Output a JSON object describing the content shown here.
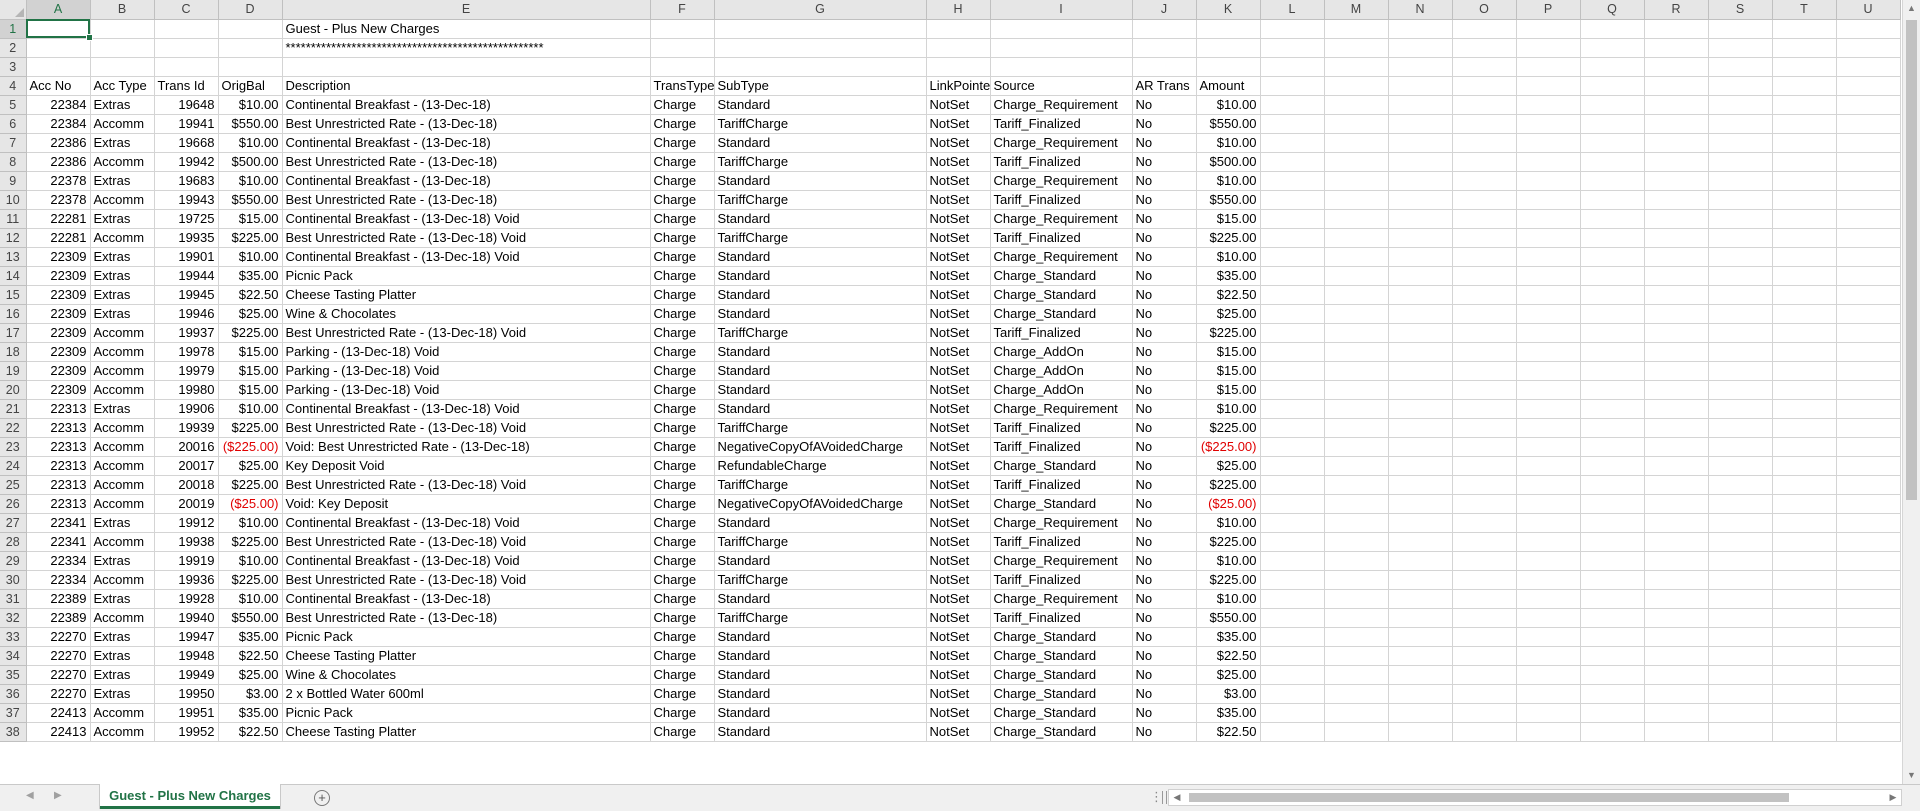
{
  "columns": [
    "A",
    "B",
    "C",
    "D",
    "E",
    "F",
    "G",
    "H",
    "I",
    "J",
    "K",
    "L",
    "M",
    "N",
    "O",
    "P",
    "Q",
    "R",
    "S",
    "T",
    "U"
  ],
  "selected_cell": "A1",
  "title_row": {
    "report_title": "Guest - Plus New Charges",
    "underline": "***************************************************"
  },
  "headers": [
    "Acc No",
    "Acc Type",
    "Trans Id",
    "OrigBal",
    "Description",
    "TransType",
    "SubType",
    "LinkPointe",
    "Source",
    "AR Trans",
    "Amount"
  ],
  "rows": [
    [
      "22384",
      "Extras",
      "19648",
      "$10.00",
      "Continental Breakfast - (13-Dec-18)",
      "Charge",
      "Standard",
      "NotSet",
      "Charge_Requirement",
      "No",
      "$10.00"
    ],
    [
      "22384",
      "Accomm",
      "19941",
      "$550.00",
      "Best Unrestricted Rate - (13-Dec-18)",
      "Charge",
      "TariffCharge",
      "NotSet",
      "Tariff_Finalized",
      "No",
      "$550.00"
    ],
    [
      "22386",
      "Extras",
      "19668",
      "$10.00",
      "Continental Breakfast - (13-Dec-18)",
      "Charge",
      "Standard",
      "NotSet",
      "Charge_Requirement",
      "No",
      "$10.00"
    ],
    [
      "22386",
      "Accomm",
      "19942",
      "$500.00",
      "Best Unrestricted Rate - (13-Dec-18)",
      "Charge",
      "TariffCharge",
      "NotSet",
      "Tariff_Finalized",
      "No",
      "$500.00"
    ],
    [
      "22378",
      "Extras",
      "19683",
      "$10.00",
      "Continental Breakfast - (13-Dec-18)",
      "Charge",
      "Standard",
      "NotSet",
      "Charge_Requirement",
      "No",
      "$10.00"
    ],
    [
      "22378",
      "Accomm",
      "19943",
      "$550.00",
      "Best Unrestricted Rate - (13-Dec-18)",
      "Charge",
      "TariffCharge",
      "NotSet",
      "Tariff_Finalized",
      "No",
      "$550.00"
    ],
    [
      "22281",
      "Extras",
      "19725",
      "$15.00",
      "Continental Breakfast - (13-Dec-18) Void",
      "Charge",
      "Standard",
      "NotSet",
      "Charge_Requirement",
      "No",
      "$15.00"
    ],
    [
      "22281",
      "Accomm",
      "19935",
      "$225.00",
      "Best Unrestricted Rate - (13-Dec-18) Void",
      "Charge",
      "TariffCharge",
      "NotSet",
      "Tariff_Finalized",
      "No",
      "$225.00"
    ],
    [
      "22309",
      "Extras",
      "19901",
      "$10.00",
      "Continental Breakfast - (13-Dec-18) Void",
      "Charge",
      "Standard",
      "NotSet",
      "Charge_Requirement",
      "No",
      "$10.00"
    ],
    [
      "22309",
      "Extras",
      "19944",
      "$35.00",
      "Picnic Pack",
      "Charge",
      "Standard",
      "NotSet",
      "Charge_Standard",
      "No",
      "$35.00"
    ],
    [
      "22309",
      "Extras",
      "19945",
      "$22.50",
      "Cheese Tasting Platter",
      "Charge",
      "Standard",
      "NotSet",
      "Charge_Standard",
      "No",
      "$22.50"
    ],
    [
      "22309",
      "Extras",
      "19946",
      "$25.00",
      "Wine & Chocolates",
      "Charge",
      "Standard",
      "NotSet",
      "Charge_Standard",
      "No",
      "$25.00"
    ],
    [
      "22309",
      "Accomm",
      "19937",
      "$225.00",
      "Best Unrestricted Rate - (13-Dec-18) Void",
      "Charge",
      "TariffCharge",
      "NotSet",
      "Tariff_Finalized",
      "No",
      "$225.00"
    ],
    [
      "22309",
      "Accomm",
      "19978",
      "$15.00",
      "Parking - (13-Dec-18) Void",
      "Charge",
      "Standard",
      "NotSet",
      "Charge_AddOn",
      "No",
      "$15.00"
    ],
    [
      "22309",
      "Accomm",
      "19979",
      "$15.00",
      "Parking - (13-Dec-18) Void",
      "Charge",
      "Standard",
      "NotSet",
      "Charge_AddOn",
      "No",
      "$15.00"
    ],
    [
      "22309",
      "Accomm",
      "19980",
      "$15.00",
      "Parking - (13-Dec-18) Void",
      "Charge",
      "Standard",
      "NotSet",
      "Charge_AddOn",
      "No",
      "$15.00"
    ],
    [
      "22313",
      "Extras",
      "19906",
      "$10.00",
      "Continental Breakfast - (13-Dec-18) Void",
      "Charge",
      "Standard",
      "NotSet",
      "Charge_Requirement",
      "No",
      "$10.00"
    ],
    [
      "22313",
      "Accomm",
      "19939",
      "$225.00",
      "Best Unrestricted Rate - (13-Dec-18) Void",
      "Charge",
      "TariffCharge",
      "NotSet",
      "Tariff_Finalized",
      "No",
      "$225.00"
    ],
    [
      "22313",
      "Accomm",
      "20016",
      "($225.00)",
      "Void: Best Unrestricted Rate - (13-Dec-18)",
      "Charge",
      "NegativeCopyOfAVoidedCharge",
      "NotSet",
      "Tariff_Finalized",
      "No",
      "($225.00)"
    ],
    [
      "22313",
      "Accomm",
      "20017",
      "$25.00",
      "Key Deposit Void",
      "Charge",
      "RefundableCharge",
      "NotSet",
      "Charge_Standard",
      "No",
      "$25.00"
    ],
    [
      "22313",
      "Accomm",
      "20018",
      "$225.00",
      "Best Unrestricted Rate - (13-Dec-18) Void",
      "Charge",
      "TariffCharge",
      "NotSet",
      "Tariff_Finalized",
      "No",
      "$225.00"
    ],
    [
      "22313",
      "Accomm",
      "20019",
      "($25.00)",
      "Void: Key Deposit",
      "Charge",
      "NegativeCopyOfAVoidedCharge",
      "NotSet",
      "Charge_Standard",
      "No",
      "($25.00)"
    ],
    [
      "22341",
      "Extras",
      "19912",
      "$10.00",
      "Continental Breakfast - (13-Dec-18) Void",
      "Charge",
      "Standard",
      "NotSet",
      "Charge_Requirement",
      "No",
      "$10.00"
    ],
    [
      "22341",
      "Accomm",
      "19938",
      "$225.00",
      "Best Unrestricted Rate - (13-Dec-18) Void",
      "Charge",
      "TariffCharge",
      "NotSet",
      "Tariff_Finalized",
      "No",
      "$225.00"
    ],
    [
      "22334",
      "Extras",
      "19919",
      "$10.00",
      "Continental Breakfast - (13-Dec-18) Void",
      "Charge",
      "Standard",
      "NotSet",
      "Charge_Requirement",
      "No",
      "$10.00"
    ],
    [
      "22334",
      "Accomm",
      "19936",
      "$225.00",
      "Best Unrestricted Rate - (13-Dec-18) Void",
      "Charge",
      "TariffCharge",
      "NotSet",
      "Tariff_Finalized",
      "No",
      "$225.00"
    ],
    [
      "22389",
      "Extras",
      "19928",
      "$10.00",
      "Continental Breakfast - (13-Dec-18)",
      "Charge",
      "Standard",
      "NotSet",
      "Charge_Requirement",
      "No",
      "$10.00"
    ],
    [
      "22389",
      "Accomm",
      "19940",
      "$550.00",
      "Best Unrestricted Rate - (13-Dec-18)",
      "Charge",
      "TariffCharge",
      "NotSet",
      "Tariff_Finalized",
      "No",
      "$550.00"
    ],
    [
      "22270",
      "Extras",
      "19947",
      "$35.00",
      "Picnic Pack",
      "Charge",
      "Standard",
      "NotSet",
      "Charge_Standard",
      "No",
      "$35.00"
    ],
    [
      "22270",
      "Extras",
      "19948",
      "$22.50",
      "Cheese Tasting Platter",
      "Charge",
      "Standard",
      "NotSet",
      "Charge_Standard",
      "No",
      "$22.50"
    ],
    [
      "22270",
      "Extras",
      "19949",
      "$25.00",
      "Wine & Chocolates",
      "Charge",
      "Standard",
      "NotSet",
      "Charge_Standard",
      "No",
      "$25.00"
    ],
    [
      "22270",
      "Extras",
      "19950",
      "$3.00",
      "2 x Bottled Water 600ml",
      "Charge",
      "Standard",
      "NotSet",
      "Charge_Standard",
      "No",
      "$3.00"
    ],
    [
      "22413",
      "Accomm",
      "19951",
      "$35.00",
      "Picnic Pack",
      "Charge",
      "Standard",
      "NotSet",
      "Charge_Standard",
      "No",
      "$35.00"
    ],
    [
      "22413",
      "Accomm",
      "19952",
      "$22.50",
      "Cheese Tasting Platter",
      "Charge",
      "Standard",
      "NotSet",
      "Charge_Standard",
      "No",
      "$22.50"
    ]
  ],
  "negative_color": "#e00000",
  "accent_color": "#217346",
  "sheet_tab": {
    "label": "Guest - Plus New Charges"
  },
  "icons": {
    "add_sheet": "plus-circle-icon",
    "tab_prev": "triangle-left-icon",
    "tab_next": "triangle-right-icon"
  }
}
